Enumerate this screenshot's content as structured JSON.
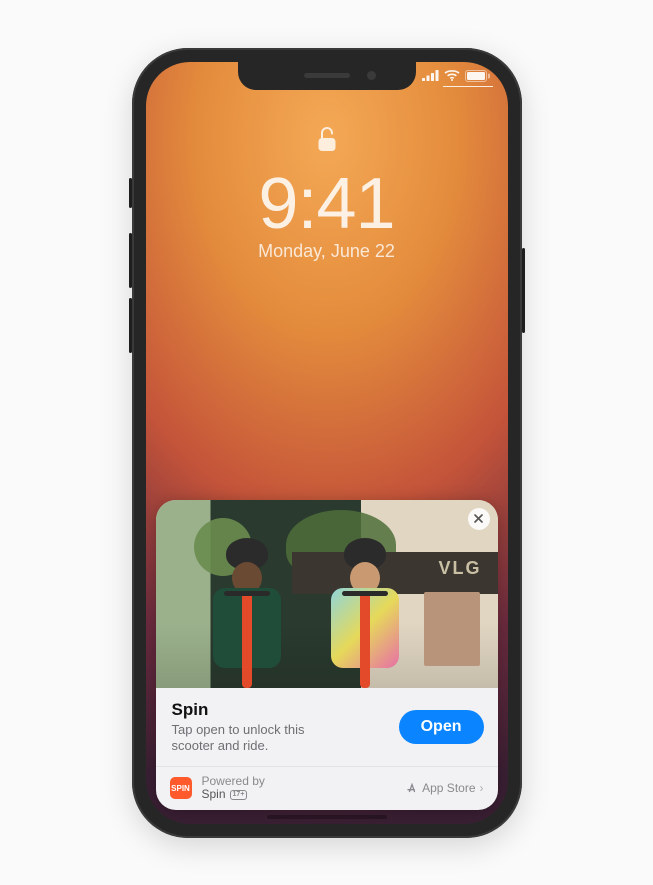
{
  "lockscreen": {
    "time": "9:41",
    "date": "Monday, June 22"
  },
  "appclip": {
    "title": "Spin",
    "description": "Tap open to unlock this scooter and ride.",
    "open_label": "Open",
    "hero_store_sign": "VLG",
    "footer": {
      "powered_by_label": "Powered by",
      "app_name": "Spin",
      "app_icon_text": "SPIN",
      "age_rating": "17+",
      "appstore_label": "App Store"
    }
  },
  "icons": {
    "lock": "lock-open-icon",
    "signal": "cellular-signal-icon",
    "wifi": "wifi-icon",
    "battery": "battery-icon",
    "close": "close-icon",
    "appstore": "appstore-a-icon",
    "chevron": "chevron-right-icon"
  }
}
